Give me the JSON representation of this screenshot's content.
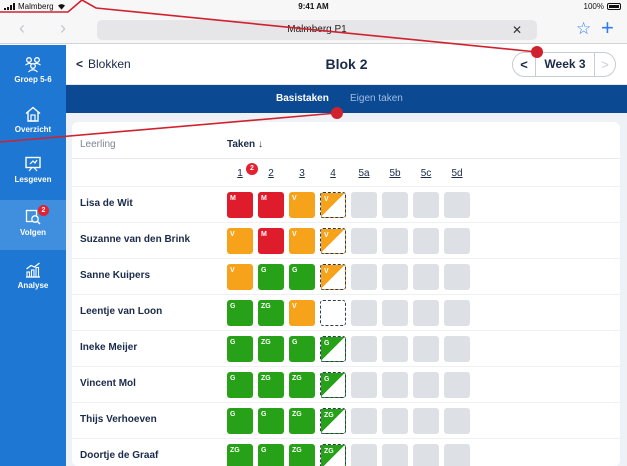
{
  "status_bar": {
    "carrier": "Malmberg",
    "time": "9:41 AM",
    "battery": "100%"
  },
  "browser": {
    "url": "Malmberg P1",
    "back_glyph": "‹",
    "forward_glyph": "›",
    "clear_glyph": "✕",
    "bookmark_glyph": "☆",
    "new_tab_glyph": "+",
    "accent_color": "#2f7cf6"
  },
  "sidebar": {
    "color": "#1e77d3",
    "items": [
      {
        "label": "Groep 5-6",
        "icon": "group-icon"
      },
      {
        "label": "Overzicht",
        "icon": "home-icon"
      },
      {
        "label": "Lesgeven",
        "icon": "whiteboard-icon"
      },
      {
        "label": "Volgen",
        "icon": "follow-icon",
        "badge": "2",
        "active": true
      },
      {
        "label": "Analyse",
        "icon": "analytics-icon"
      }
    ]
  },
  "header": {
    "back_label": "Blokken",
    "title": "Blok 2",
    "week_label": "Week 3"
  },
  "tabs": [
    {
      "label": "Basistaken",
      "active": true
    },
    {
      "label": "Eigen taken",
      "active": false
    }
  ],
  "table": {
    "col_student": "Leerling",
    "col_tasks": "Taken ↓",
    "task_numbers": [
      "1",
      "2",
      "3",
      "4",
      "5a",
      "5b",
      "5c",
      "5d"
    ],
    "task_badge": "2",
    "legend": {
      "M": "#df1c2c",
      "V": "#f7a21b",
      "G": "#27a118",
      "ZG": "#27a118",
      "future": "#dde1e6"
    },
    "rows": [
      {
        "name": "Lisa de Wit",
        "scores": [
          "M",
          "M",
          "V"
        ],
        "current": "V"
      },
      {
        "name": "Suzanne van den Brink",
        "scores": [
          "V",
          "M",
          "V"
        ],
        "current": "V"
      },
      {
        "name": "Sanne Kuipers",
        "scores": [
          "V",
          "G",
          "G"
        ],
        "current": "V"
      },
      {
        "name": "Leentje van Loon",
        "scores": [
          "G",
          "ZG",
          "V"
        ],
        "current": ""
      },
      {
        "name": "Ineke Meijer",
        "scores": [
          "G",
          "ZG",
          "G"
        ],
        "current": "G"
      },
      {
        "name": "Vincent Mol",
        "scores": [
          "G",
          "ZG",
          "ZG"
        ],
        "current": "G"
      },
      {
        "name": "Thijs Verhoeven",
        "scores": [
          "G",
          "G",
          "ZG"
        ],
        "current": "ZG"
      },
      {
        "name": "Doortje de Graaf",
        "scores": [
          "ZG",
          "G",
          "ZG"
        ],
        "current": "ZG"
      }
    ]
  },
  "annotation_color": "#d0222e"
}
